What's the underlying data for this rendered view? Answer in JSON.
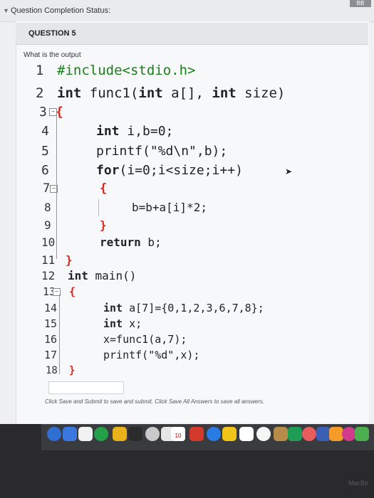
{
  "status": {
    "label": "Question Completion Status:",
    "badge": "BB"
  },
  "question": {
    "title": "QUESTION 5",
    "prompt": "What is the output"
  },
  "code": [
    {
      "n": "1",
      "segments": [
        {
          "t": "#include<stdio.h>",
          "c": "green"
        }
      ]
    },
    {
      "n": "2",
      "segments": [
        {
          "t": "int",
          "c": "kw"
        },
        {
          "t": " func1(",
          "c": ""
        },
        {
          "t": "int",
          "c": "kw"
        },
        {
          "t": " a[], ",
          "c": ""
        },
        {
          "t": "int",
          "c": "kw"
        },
        {
          "t": " size)",
          "c": ""
        }
      ]
    },
    {
      "n": "3",
      "segments": [
        {
          "t": "{",
          "c": "red"
        }
      ]
    },
    {
      "n": "4",
      "segments": [
        {
          "t": "int",
          "c": "kw"
        },
        {
          "t": " i,b=0;",
          "c": ""
        }
      ]
    },
    {
      "n": "5",
      "segments": [
        {
          "t": "printf(\"%d\\n\",b);",
          "c": ""
        }
      ]
    },
    {
      "n": "6",
      "segments": [
        {
          "t": "for",
          "c": "kw"
        },
        {
          "t": "(i=0;i<size;i++)",
          "c": ""
        }
      ]
    },
    {
      "n": "7",
      "segments": [
        {
          "t": "{",
          "c": "red"
        }
      ]
    },
    {
      "n": "8",
      "segments": [
        {
          "t": "b=b+a[i]*2;",
          "c": ""
        }
      ]
    },
    {
      "n": "9",
      "segments": [
        {
          "t": "}",
          "c": "red"
        }
      ]
    },
    {
      "n": "10",
      "segments": [
        {
          "t": "return",
          "c": "kw"
        },
        {
          "t": " b;",
          "c": ""
        }
      ]
    },
    {
      "n": "11",
      "segments": [
        {
          "t": "}",
          "c": "red"
        }
      ]
    },
    {
      "n": "12",
      "segments": [
        {
          "t": "int",
          "c": "kw"
        },
        {
          "t": " main()",
          "c": ""
        }
      ]
    },
    {
      "n": "13",
      "segments": [
        {
          "t": "{",
          "c": "red"
        }
      ]
    },
    {
      "n": "14",
      "segments": [
        {
          "t": "int",
          "c": "kw"
        },
        {
          "t": " a[7]={0,1,2,3,6,7,8};",
          "c": ""
        }
      ]
    },
    {
      "n": "15",
      "segments": [
        {
          "t": "int",
          "c": "kw"
        },
        {
          "t": " x;",
          "c": ""
        }
      ]
    },
    {
      "n": "16",
      "segments": [
        {
          "t": "x=func1(a,7);",
          "c": ""
        }
      ]
    },
    {
      "n": "17",
      "segments": [
        {
          "t": "printf(\"%d\",x);",
          "c": ""
        }
      ]
    },
    {
      "n": "18",
      "segments": [
        {
          "t": "}",
          "c": "red"
        }
      ]
    }
  ],
  "answer": {
    "value": ""
  },
  "footer": {
    "note": "Click Save and Submit to save and submit. Click Save All Answers to save all answers."
  },
  "dock": {
    "calendar_day": "10",
    "icon_colors": [
      "#2f6fd1",
      "#3a78e0",
      "#f2f2f2",
      "#24a148",
      "#e9b21a",
      "#2b2b2b",
      "#c9c9c9",
      "#e6e6e6",
      "#d33a2c",
      "#2a7be4",
      "#f0c419",
      "#ffffff",
      "#f5f5f5",
      "#b58c4a",
      "#1f9d55",
      "#e85d5d",
      "#3b5fb5",
      "#f59b2a",
      "#d23b8c",
      "#4caf50",
      "#2196f3"
    ]
  },
  "device_label": "MacBo"
}
